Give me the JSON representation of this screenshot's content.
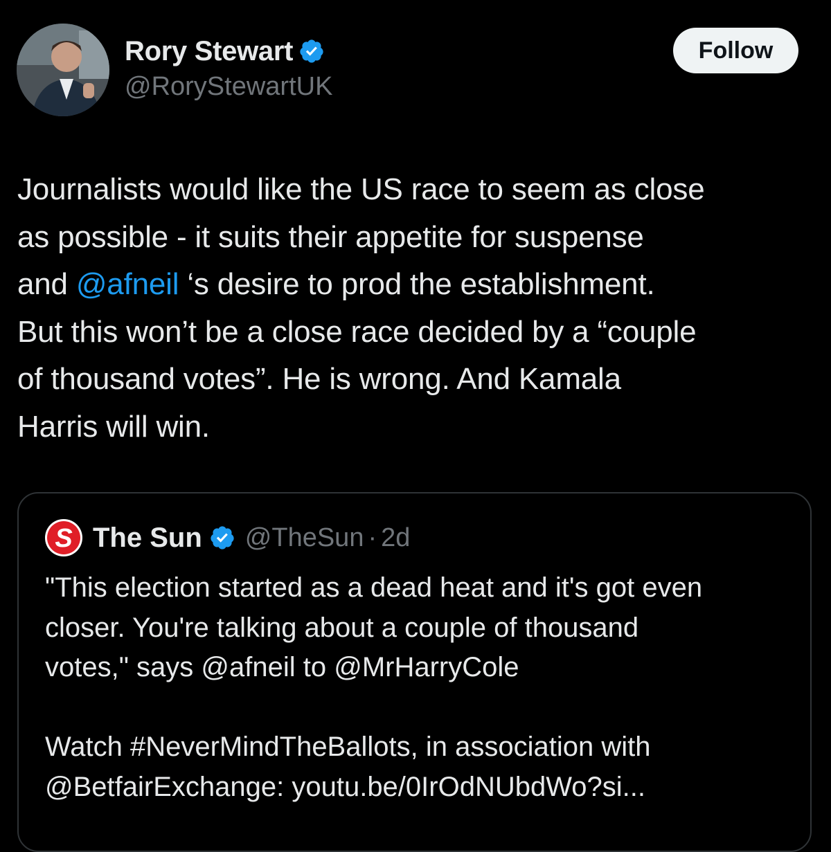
{
  "tweet": {
    "author": {
      "display_name": "Rory Stewart",
      "handle": "@RoryStewartUK",
      "verified_icon": "verified-badge-icon",
      "avatar": "profile-photo"
    },
    "follow_label": "Follow",
    "text_lines": [
      [
        {
          "t": "Journalists would like the US race to seem as close"
        }
      ],
      [
        {
          "t": "as possible - it suits their appetite for suspense"
        }
      ],
      [
        {
          "t": "and "
        },
        {
          "t": "@afneil",
          "mention": true
        },
        {
          "t": " ‘s desire to prod the establishment."
        }
      ],
      [
        {
          "t": "But this won’t be a close race decided by a “couple"
        }
      ],
      [
        {
          "t": "of thousand votes”. He is wrong. And Kamala"
        }
      ],
      [
        {
          "t": "Harris will win."
        }
      ]
    ]
  },
  "quoted_tweet": {
    "author": {
      "display_name": "The Sun",
      "handle": "@TheSun",
      "separator": "·",
      "time": "2d",
      "logo_letter": "S",
      "verified_icon": "verified-badge-icon"
    },
    "text_lines": [
      "\"This election started as a dead heat and it's got even",
      "closer. You're talking about a couple of thousand",
      "votes,\" says @afneil to @MrHarryCole",
      "",
      "Watch #NeverMindTheBallots, in association with",
      "@BetfairExchange: youtu.be/0IrOdNUbdWo?si..."
    ]
  },
  "colors": {
    "background": "#000000",
    "text": "#e7e9ea",
    "muted": "#71767b",
    "link": "#1d9bf0",
    "verified": "#1d9bf0",
    "follow_bg": "#eff3f4",
    "card_border": "#2f3336",
    "sun_red": "#e01e27"
  }
}
